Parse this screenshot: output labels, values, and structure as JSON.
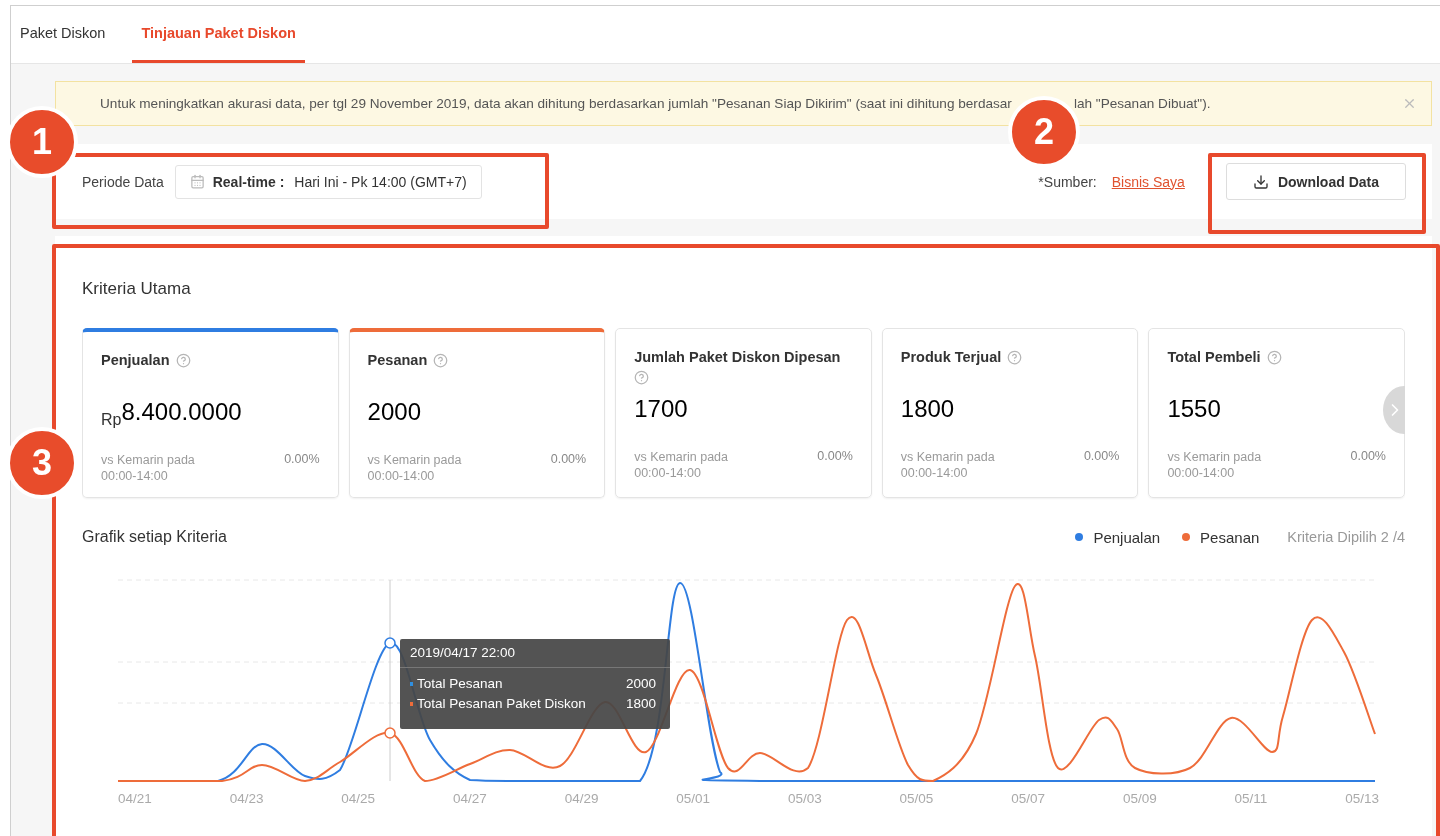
{
  "tabs": [
    {
      "label": "Paket Diskon",
      "selected": false
    },
    {
      "label": "Tinjauan Paket Diskon",
      "selected": true
    }
  ],
  "notice": {
    "text_start": "Untuk meningkatkan akurasi data, per tgl 29 November 2019, data akan dihitung berdasarkan jumlah \"Pesanan Siap Dikirim\" (saat ini dihitung berdasar",
    "text_end": "lah \"Pesanan Dibuat\")."
  },
  "period": {
    "label": "Periode Data",
    "mode": "Real-time :",
    "value": "Hari Ini - Pk 14:00 (GMT+7)"
  },
  "source": {
    "label": "*Sumber:",
    "link": "Bisnis Saya"
  },
  "download_button": "Download Data",
  "criteria": {
    "title": "Kriteria Utama",
    "cards": [
      {
        "label": "Penjualan",
        "prefix": "Rp",
        "value": "8.400.0000",
        "compare": "vs Kemarin pada",
        "range": "00:00-14:00",
        "change": "0.00%",
        "selected": true,
        "color": "#2f7de1"
      },
      {
        "label": "Pesanan",
        "value": "2000",
        "compare": "vs Kemarin pada",
        "range": "00:00-14:00",
        "change": "0.00%",
        "selected": true,
        "color": "#ee6c3a"
      },
      {
        "label": "Jumlah Paket Diskon Dipesan",
        "value": "1700",
        "compare": "vs Kemarin pada",
        "range": "00:00-14:00",
        "change": "0.00%",
        "selected": false
      },
      {
        "label": "Produk Terjual",
        "value": "1800",
        "compare": "vs Kemarin pada",
        "range": "00:00-14:00",
        "change": "0.00%",
        "selected": false
      },
      {
        "label": "Total Pembeli",
        "value": "1550",
        "compare": "vs Kemarin pada",
        "range": "00:00-14:00",
        "change": "0.00%",
        "selected": false
      }
    ]
  },
  "chart": {
    "title": "Grafik setiap Kriteria",
    "legend": [
      {
        "label": "Penjualan",
        "color": "#2f7de1"
      },
      {
        "label": "Pesanan",
        "color": "#ee6c3a"
      }
    ],
    "selection_note": "Kriteria Dipilih 2 /4",
    "x_labels": [
      "04/21",
      "04/23",
      "04/25",
      "04/27",
      "04/29",
      "05/01",
      "05/03",
      "05/05",
      "05/07",
      "05/09",
      "05/11",
      "05/13"
    ],
    "tooltip": {
      "title": "2019/04/17  22:00",
      "rows": [
        {
          "label": "Total Pesanan",
          "value": "2000",
          "color": "#2f8fe0"
        },
        {
          "label": "Total Pesanan Paket Diskon",
          "value": "1800",
          "color": "#ee6c3a"
        }
      ]
    }
  },
  "annotations": [
    {
      "number": "1"
    },
    {
      "number": "2"
    },
    {
      "number": "3"
    }
  ]
}
